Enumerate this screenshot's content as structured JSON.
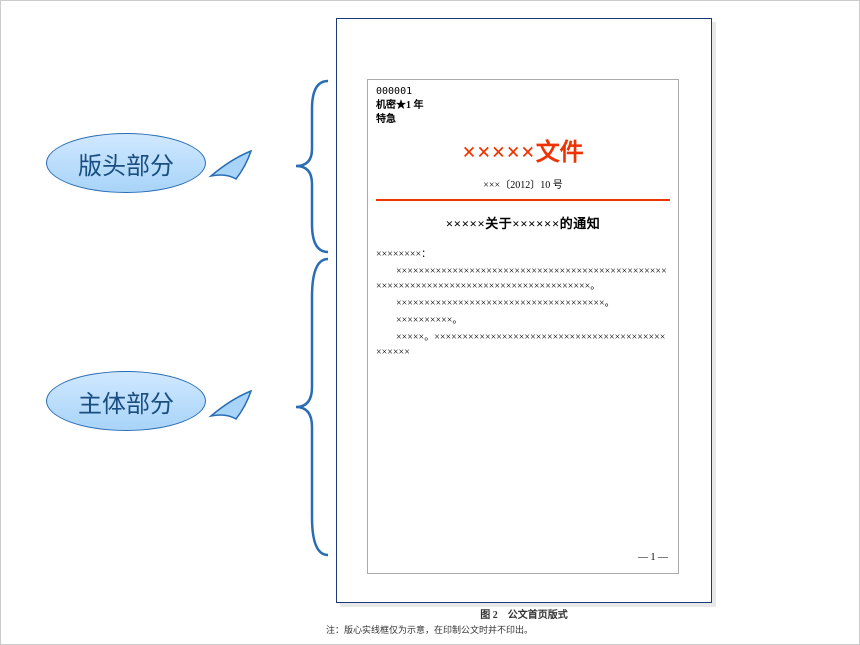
{
  "callouts": {
    "header": "版头部分",
    "body": "主体部分"
  },
  "document": {
    "serial": "000001",
    "security": "机密★1 年",
    "urgency": "特急",
    "org_marks": "×××××",
    "org_word": "文件",
    "number": "×××〔2012〕10 号",
    "subject": "×××××关于××××××的通知",
    "addressee": "××××××××：",
    "para1": "　　××××××××××××××××××××××××××××××××××××××××××××××××××××××××××××××××××××××××××××××××××××××。",
    "para2": "　　×××××××××××××××××××××××××××××××××××××。",
    "para3": "　　××××××××××。",
    "para4": "　　×××××。×××××××××××××××××××××××××××××××××××××××××××××××",
    "page_num": "— 1 —"
  },
  "caption": "图 2　公文首页版式",
  "note": "注：版心实线框仅为示意，在印制公文时并不印出。"
}
